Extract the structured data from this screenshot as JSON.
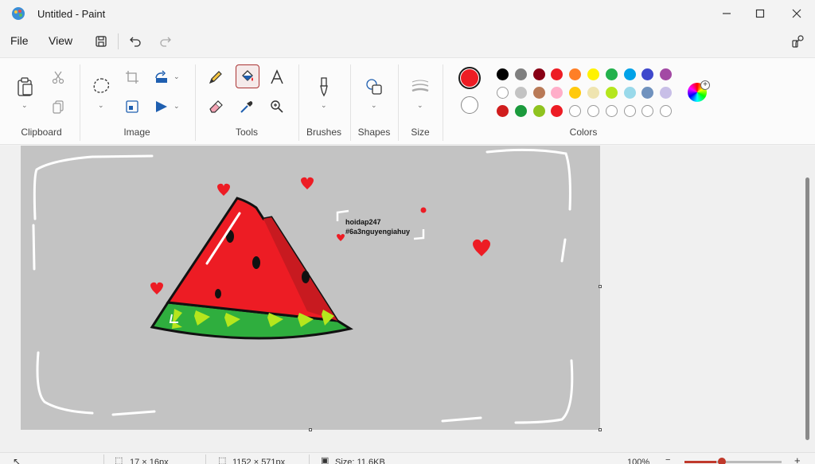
{
  "window": {
    "title": "Untitled - Paint"
  },
  "menu": {
    "file": "File",
    "view": "View"
  },
  "ribbon": {
    "groups": {
      "clipboard": "Clipboard",
      "image": "Image",
      "tools": "Tools",
      "brushes": "Brushes",
      "shapes": "Shapes",
      "size": "Size",
      "colors": "Colors"
    },
    "selected_tool": "fill-icon",
    "color1": "#ed1c24",
    "color2": "#ffffff",
    "palette": [
      [
        "#000000",
        "#7f7f7f",
        "#880015",
        "#ed1c24",
        "#ff7f27",
        "#fff200",
        "#22b14c",
        "#00a2e8",
        "#3f48cc",
        "#a349a4"
      ],
      [
        "#ffffff",
        "#c3c3c3",
        "#b97a57",
        "#ffaec9",
        "#ffc90e",
        "#efe4b0",
        "#b5e61d",
        "#99d9ea",
        "#7092be",
        "#c8bfe7"
      ],
      [
        "#d01c1c",
        "#1b9a3c",
        "#8fc31f",
        "#ed1c24",
        "",
        "",
        "",
        "",
        "",
        ""
      ]
    ]
  },
  "canvas": {
    "text_line1": "hoidap247",
    "text_line2": "#6a3nguyengiahuy",
    "background": "#c3c3c3"
  },
  "status": {
    "selection": "17 × 16px",
    "canvas_size": "1152 × 571px",
    "file_size": "Size: 11.6KB",
    "zoom": "100%"
  }
}
